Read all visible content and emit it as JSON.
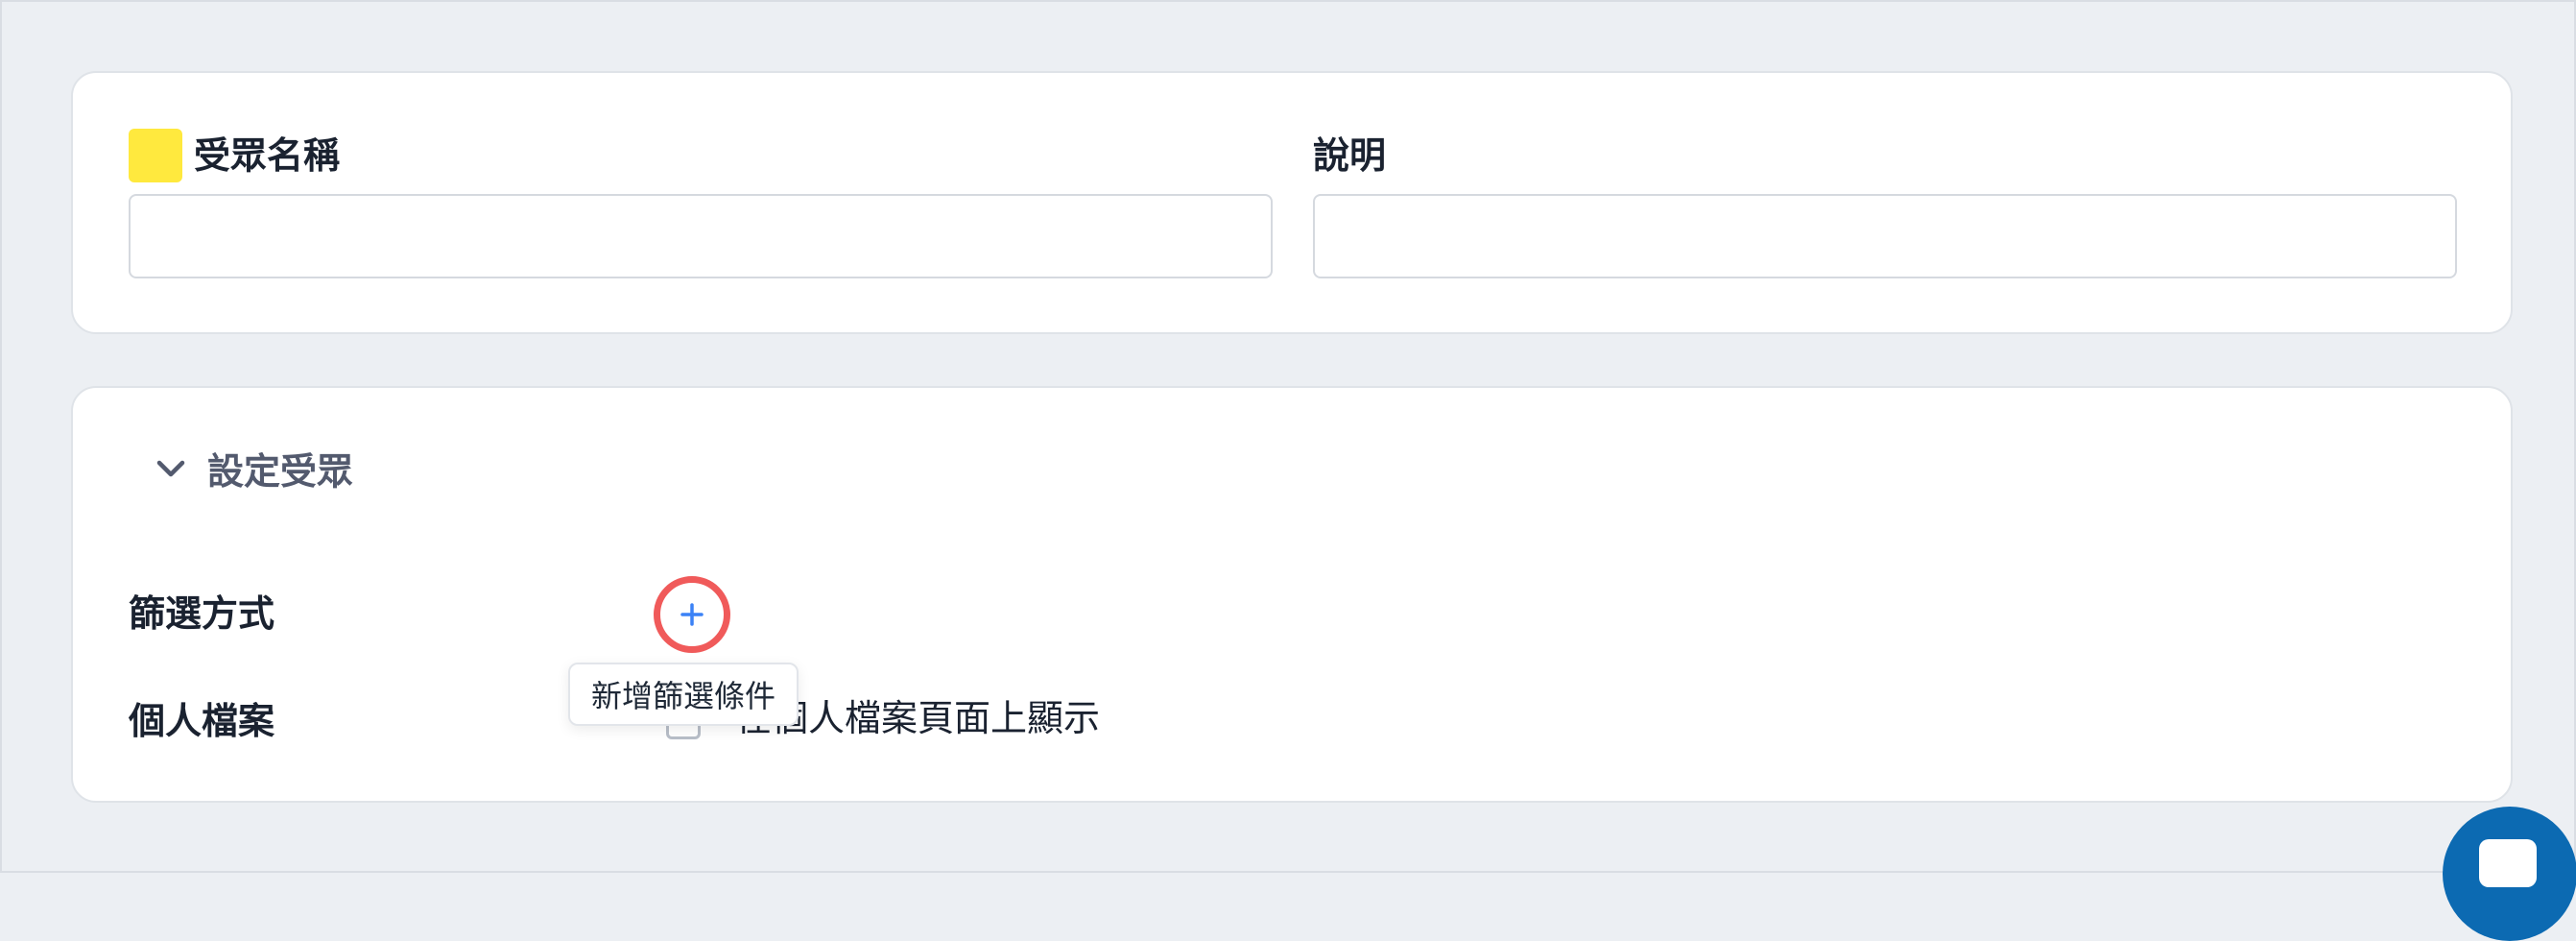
{
  "name_card": {
    "audience_name_label": "受眾名稱",
    "audience_name_value": "",
    "description_label": "說明",
    "description_value": ""
  },
  "audience_card": {
    "section_title": "設定受眾",
    "filter_method_label": "篩選方式",
    "profile_label": "個人檔案",
    "profile_checkbox_label": "在個人檔案頁面上顯示",
    "profile_checkbox_checked": false,
    "add_filter_tooltip": "新增篩選條件"
  },
  "colors": {
    "name_swatch": "#ffe93e",
    "add_button_highlight": "#f05a5a",
    "add_icon": "#3b82f6",
    "chat_button": "#0c6ab2"
  },
  "icons": {
    "section_toggle": "chevron-down-icon",
    "add_filter": "plus-icon",
    "chat": "chat-icon"
  }
}
